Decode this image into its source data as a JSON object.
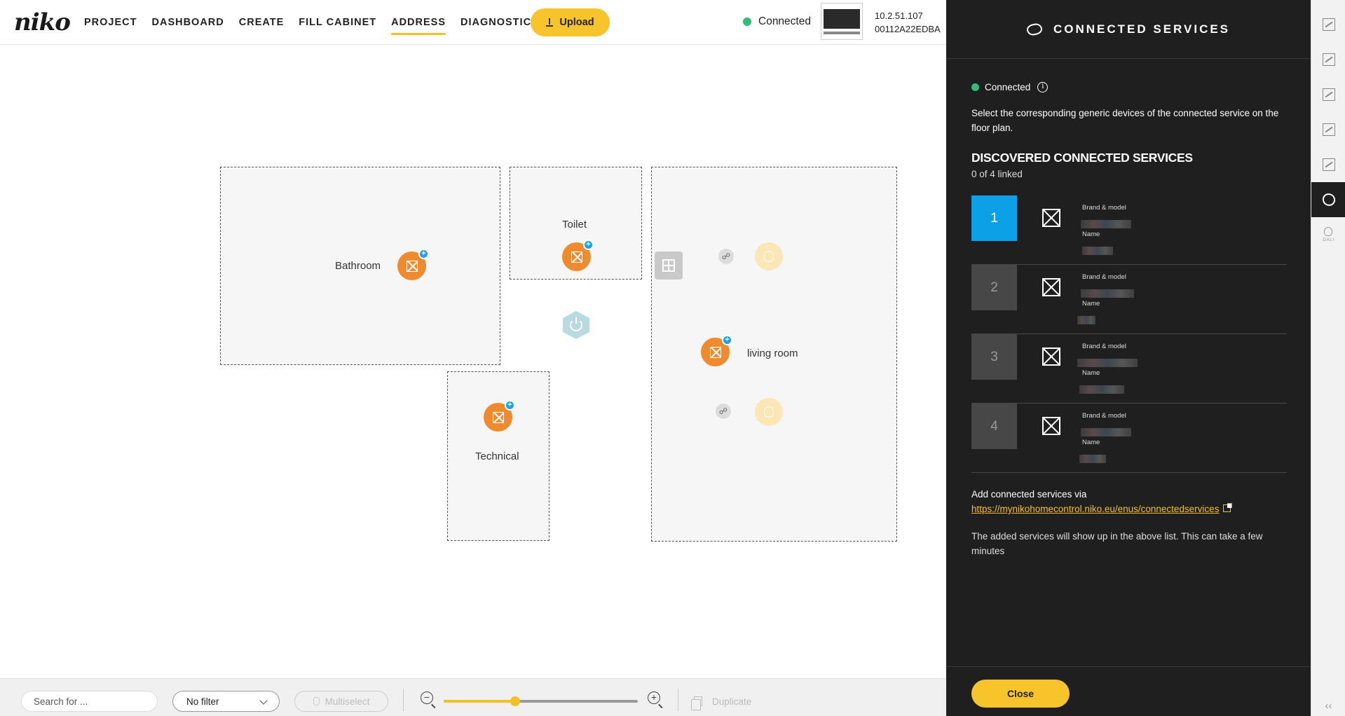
{
  "brand": {
    "logo": "niko"
  },
  "nav": [
    {
      "label": "PROJECT",
      "name": "nav-project",
      "active": false
    },
    {
      "label": "DASHBOARD",
      "name": "nav-dashboard",
      "active": false
    },
    {
      "label": "CREATE",
      "name": "nav-create",
      "active": false
    },
    {
      "label": "FILL CABINET",
      "name": "nav-fill-cabinet",
      "active": false
    },
    {
      "label": "ADDRESS",
      "name": "nav-address",
      "active": true
    },
    {
      "label": "DIAGNOSTICS",
      "name": "nav-diagnostics",
      "active": false,
      "external": true
    }
  ],
  "toolbar": {
    "upload_label": "Upload"
  },
  "status": {
    "connection": "Connected",
    "ip": "10.2.51.107",
    "mac": "00112A22EDBA"
  },
  "floorplan": {
    "rooms": [
      {
        "name": "bathroom",
        "label": "Bathroom"
      },
      {
        "name": "toilet",
        "label": "Toilet"
      },
      {
        "name": "technical",
        "label": "Technical"
      },
      {
        "name": "living-room",
        "label": "living room"
      }
    ]
  },
  "bottombar": {
    "search_placeholder": "Search for ...",
    "filter_value": "No filter",
    "multiselect_label": "Multiselect",
    "duplicate_label": "Duplicate",
    "zoom_level": 0.37
  },
  "panel": {
    "title": "CONNECTED SERVICES",
    "status": "Connected",
    "description": "Select the corresponding generic devices of the connected service on the floor plan.",
    "heading": "DISCOVERED CONNECTED SERVICES",
    "linked_count": "0 of 4 linked",
    "services": [
      {
        "number": "1",
        "brand_label": "Brand & model",
        "name_label": "Name",
        "selected": true
      },
      {
        "number": "2",
        "brand_label": "Brand & model",
        "name_label": "Name",
        "selected": false
      },
      {
        "number": "3",
        "brand_label": "Brand & model",
        "name_label": "Name",
        "selected": false
      },
      {
        "number": "4",
        "brand_label": "Brand & model",
        "name_label": "Name",
        "selected": false
      }
    ],
    "add_text": "Add connected services via",
    "add_link": "https://mynikohomecontrol.niko.eu/enus/connectedservices",
    "note": "The added services will show up in the above list. This can take a few minutes",
    "close_label": "Close"
  },
  "rail": {
    "items": [
      {
        "name": "rail-floorplan-icon",
        "active": false
      },
      {
        "name": "rail-layer-icon",
        "active": false
      },
      {
        "name": "rail-touch-icon",
        "active": false
      },
      {
        "name": "rail-edit-icon",
        "active": false
      },
      {
        "name": "rail-map-icon",
        "active": false
      },
      {
        "name": "rail-connected-services-icon",
        "active": true
      }
    ],
    "dali_label": "DALI",
    "collapse_glyph": "‹‹"
  },
  "colors": {
    "accent": "#f8c42c",
    "device_orange": "#f08a2e",
    "selected_blue": "#0ca0e6",
    "panel_bg": "#1f1f1f",
    "connected_green": "#2ebd7a"
  }
}
